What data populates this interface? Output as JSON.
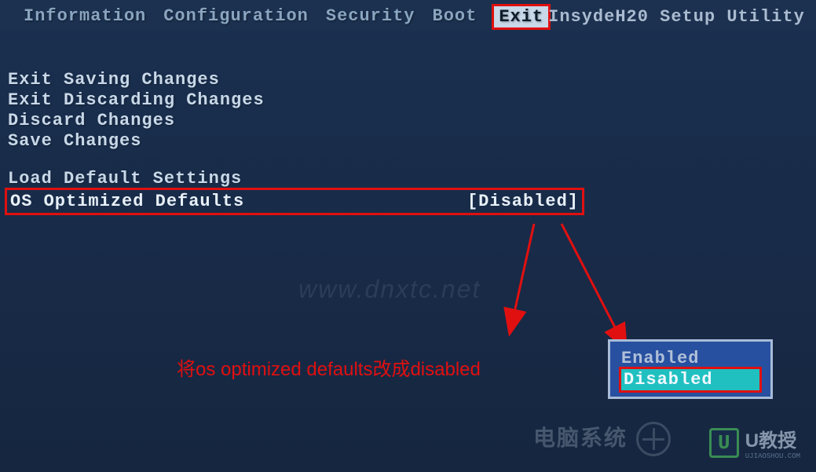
{
  "header": {
    "utility_name": "InsydeH20 Setup Utility",
    "tabs": [
      {
        "label": "Information",
        "active": false
      },
      {
        "label": "Configuration",
        "active": false
      },
      {
        "label": "Security",
        "active": false
      },
      {
        "label": "Boot",
        "active": false
      },
      {
        "label": "Exit",
        "active": true
      }
    ]
  },
  "menu": {
    "items": [
      "Exit Saving Changes",
      "Exit Discarding Changes",
      "Discard Changes",
      "Save Changes"
    ],
    "items2": [
      "Load Default Settings"
    ],
    "highlighted": {
      "label": "OS Optimized Defaults",
      "value": "[Disabled]"
    }
  },
  "popup": {
    "options": [
      {
        "label": "Enabled",
        "selected": false
      },
      {
        "label": "Disabled",
        "selected": true
      }
    ]
  },
  "annotation": {
    "text": "将os optimized defaults改成disabled"
  },
  "watermarks": {
    "center": "www.dnxtc.net",
    "right_main": "U教授",
    "right_sub": "UJIAOSHOU.COM",
    "right_badge": "U",
    "left_text": "电脑系统"
  }
}
